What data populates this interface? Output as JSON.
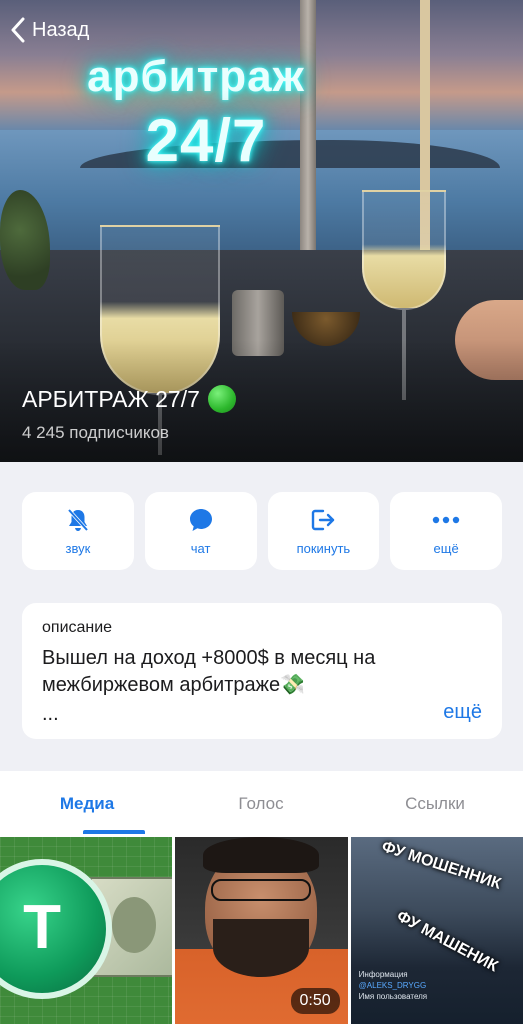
{
  "nav": {
    "back_label": "Назад"
  },
  "hero": {
    "overlay_line1": "арбитраж",
    "overlay_line2": "24/7",
    "channel_name": "АРБИТРАЖ 27/7",
    "subscribers": "4 245 подписчиков",
    "status_color": "#2db82d"
  },
  "actions": [
    {
      "label": "звук",
      "icon": "bell-muted-icon"
    },
    {
      "label": "чат",
      "icon": "chat-bubble-icon"
    },
    {
      "label": "покинуть",
      "icon": "leave-icon"
    },
    {
      "label": "ещё",
      "icon": "more-dots-icon"
    }
  ],
  "description": {
    "label": "описание",
    "text": "Вышел на доход +8000$ в месяц на межбиржевом арбитраже💸",
    "ellipsis": "...",
    "more": "ещё"
  },
  "tabs": [
    {
      "label": "Медиа",
      "active": true
    },
    {
      "label": "Голос",
      "active": false
    },
    {
      "label": "Ссылки",
      "active": false
    }
  ],
  "media": {
    "video_duration": "0:50",
    "scam_text_1": "ФУ МОШЕННИК",
    "scam_text_2": "ФУ МАШЕНИК",
    "info_heading": "Информация",
    "info_handle": "@ALEKS_DRYGG",
    "info_caption": "Имя пользователя"
  },
  "colors": {
    "accent": "#1e78e6",
    "background": "#eff0f5"
  }
}
